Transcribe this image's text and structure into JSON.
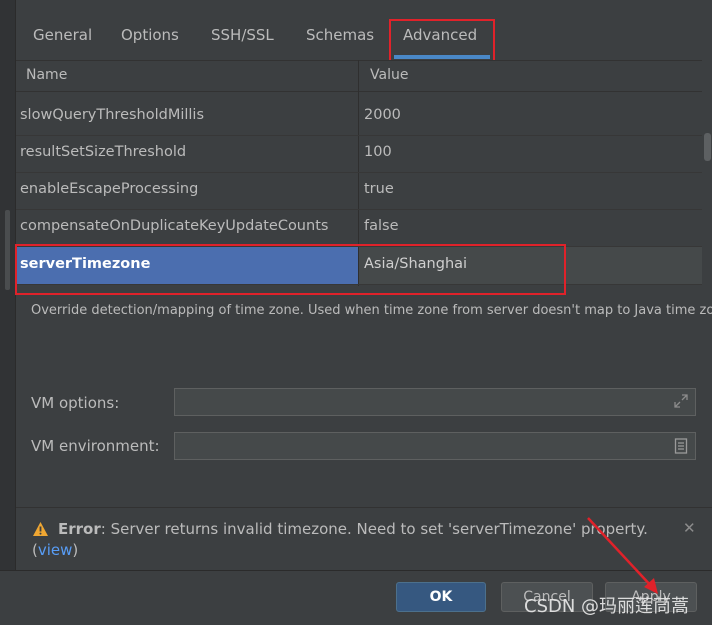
{
  "tabs": [
    {
      "label": "General"
    },
    {
      "label": "Options"
    },
    {
      "label": "SSH/SSL"
    },
    {
      "label": "Schemas"
    },
    {
      "label": "Advanced"
    }
  ],
  "table": {
    "col_name": "Name",
    "col_value": "Value",
    "rows": [
      {
        "name": "slowQueryThresholdMillis",
        "value": "2000"
      },
      {
        "name": "resultSetSizeThreshold",
        "value": "100"
      },
      {
        "name": "enableEscapeProcessing",
        "value": "true"
      },
      {
        "name": "compensateOnDuplicateKeyUpdateCounts",
        "value": "false"
      },
      {
        "name": "serverTimezone",
        "value": "Asia/Shanghai"
      }
    ],
    "selected_index": 4
  },
  "description": "Override detection/mapping of time zone. Used when time zone from server doesn't map to Java time zone",
  "vm_options": {
    "label": "VM options:",
    "value": ""
  },
  "vm_environment": {
    "label": "VM environment:",
    "value": ""
  },
  "error": {
    "prefix": "Error",
    "message": ": Server returns invalid timezone. Need to set 'serverTimezone' property.",
    "link_open": "(",
    "link": "view",
    "link_close": ")"
  },
  "buttons": {
    "ok": "OK",
    "cancel": "Cancel",
    "apply": "Apply"
  },
  "watermark": "CSDN @玛丽莲茼蒿",
  "colors": {
    "accent_red": "#e0222a",
    "selection_blue": "#4b6eaf",
    "link_blue": "#589df6",
    "warning_yellow": "#f0a732"
  }
}
